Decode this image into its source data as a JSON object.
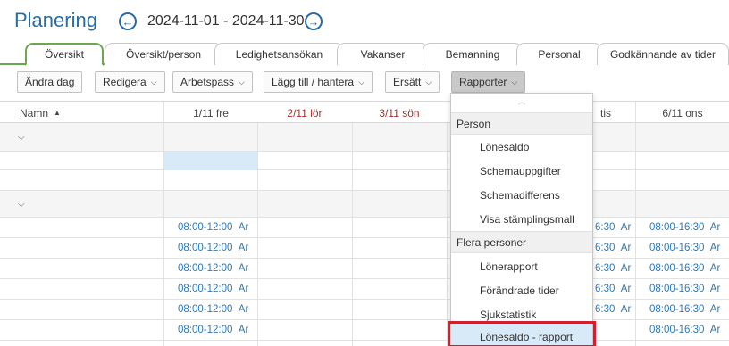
{
  "header": {
    "title": "Planering",
    "date_range": "2024-11-01 - 2024-11-30",
    "prev_symbol": "←",
    "next_symbol": "→"
  },
  "tabs": [
    "Översikt",
    "Översikt/person",
    "Ledighetsansökan",
    "Vakanser",
    "Bemanning",
    "Personal",
    "Godkännande av tider"
  ],
  "active_tab": "Översikt",
  "toolbar": {
    "andra_dag": "Ändra dag",
    "redigera": "Redigera",
    "arbetspass": "Arbetspass",
    "lagg_till": "Lägg till / hantera",
    "ersatt": "Ersätt",
    "rapporter": "Rapporter"
  },
  "grid": {
    "name_header": "Namn",
    "sort_symbol": "▲",
    "days": [
      "1/11 fre",
      "2/11 lör",
      "3/11 sön",
      "tis",
      "6/11 ons"
    ],
    "weekend_days": [
      "2/11 lör",
      "3/11 sön"
    ],
    "shift_text": "08:00-12:00",
    "shift_text_long": "08:00-16:30",
    "shift_code": "Ar",
    "partial_shift": "6:30"
  },
  "dropdown": {
    "section_person": "Person",
    "person_items": [
      "Lönesaldo",
      "Schemauppgifter",
      "Schemadifferens",
      "Visa stämplingsmall"
    ],
    "section_flera": "Flera personer",
    "flera_items": [
      "Lönerapport",
      "Förändrade tider",
      "Sjukstatistik",
      "Lönesaldo - rapport"
    ]
  },
  "colors": {
    "accent": "#2b6ca3",
    "tab_green": "#6aa84f",
    "weekend": "#a0332d",
    "shift_blue": "#2f78b5",
    "highlight_red": "#d11f2f"
  }
}
